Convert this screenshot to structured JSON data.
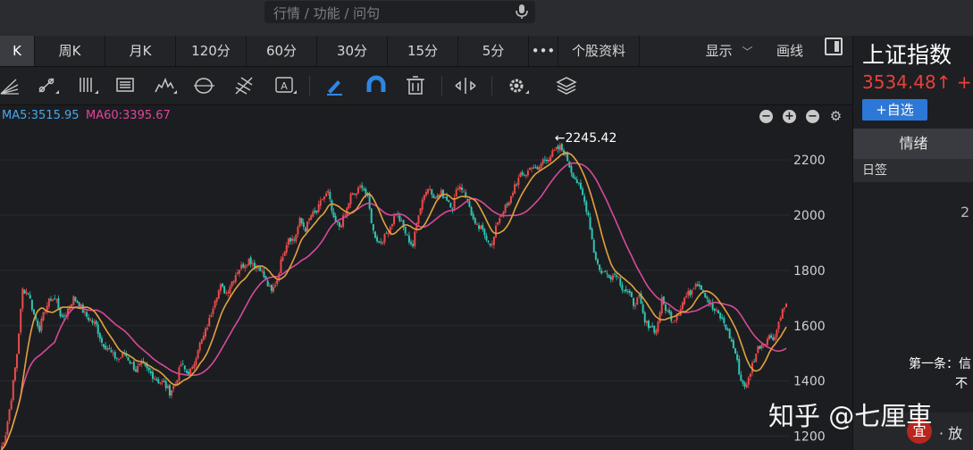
{
  "search": {
    "placeholder": "行情 / 功能 / 问句"
  },
  "periods": [
    {
      "label": "K",
      "active": true
    },
    {
      "label": "周K"
    },
    {
      "label": "月K"
    },
    {
      "label": "120分"
    },
    {
      "label": "60分"
    },
    {
      "label": "30分"
    },
    {
      "label": "15分"
    },
    {
      "label": "5分"
    },
    {
      "label": "•••"
    },
    {
      "label": "个股资料"
    }
  ],
  "toolbar_right": {
    "display_label": "显示",
    "draw_label": "画线"
  },
  "tool_icons": [
    "fan-lines-icon",
    "trend-line-icon",
    "parallel-lines-icon",
    "text-lines-icon",
    "wave-line-icon",
    "cycle-icon",
    "fibonacci-icon",
    "text-annotation-icon",
    "pen-icon",
    "magnet-icon",
    "trash-icon",
    "move-icon",
    "settings-icon",
    "layers-icon"
  ],
  "indicators": {
    "ma5": "MA5:3515.95",
    "ma60": "MA60:3395.67"
  },
  "chart_data": {
    "type": "candlestick",
    "ylim": [
      1150,
      2320
    ],
    "y_ticks": [
      "2200",
      "2000",
      "1800",
      "1600",
      "1400",
      "1200"
    ],
    "peak_label": "2245.42",
    "series": [
      {
        "name": "MA5",
        "color": "#e2a23c"
      },
      {
        "name": "MA60",
        "color": "#d64a9a"
      }
    ],
    "price_path": [
      1140,
      1210,
      1340,
      1500,
      1730,
      1720,
      1640,
      1590,
      1660,
      1700,
      1690,
      1620,
      1660,
      1700,
      1680,
      1640,
      1620,
      1600,
      1540,
      1520,
      1490,
      1480,
      1500,
      1470,
      1440,
      1460,
      1440,
      1420,
      1400,
      1390,
      1360,
      1390,
      1460,
      1430,
      1440,
      1520,
      1560,
      1620,
      1700,
      1740,
      1720,
      1760,
      1800,
      1820,
      1840,
      1820,
      1810,
      1760,
      1720,
      1770,
      1860,
      1920,
      1910,
      1980,
      1950,
      2000,
      2010,
      2060,
      2080,
      1980,
      1960,
      2000,
      2070,
      2080,
      2110,
      2060,
      1940,
      1900,
      1920,
      1960,
      2010,
      1970,
      1920,
      1890,
      2010,
      2080,
      2100,
      2060,
      2080,
      2060,
      2030,
      2110,
      2090,
      2030,
      1960,
      1950,
      1920,
      1890,
      1980,
      2020,
      2040,
      2110,
      2140,
      2150,
      2180,
      2160,
      2200,
      2210,
      2230,
      2245,
      2220,
      2160,
      2120,
      2070,
      2000,
      1870,
      1800,
      1790,
      1780,
      1790,
      1740,
      1720,
      1680,
      1700,
      1610,
      1600,
      1580,
      1690,
      1650,
      1620,
      1650,
      1700,
      1720,
      1760,
      1740,
      1700,
      1660,
      1640,
      1610,
      1560,
      1500,
      1400,
      1380,
      1460,
      1520,
      1540,
      1560,
      1560,
      1640,
      1680
    ]
  },
  "quote": {
    "name": "上证指数",
    "price": "3534.48↑ +",
    "watchlist_btn": "+自选"
  },
  "side_panel": {
    "tab_label": "情绪",
    "row_label": "日签",
    "fragment_num": "2",
    "fragment_1": "第一条：信",
    "fragment_2": "不",
    "bottom_badge": "宜",
    "bottom_text": "· 放"
  },
  "watermark": "知乎 @七厘車"
}
